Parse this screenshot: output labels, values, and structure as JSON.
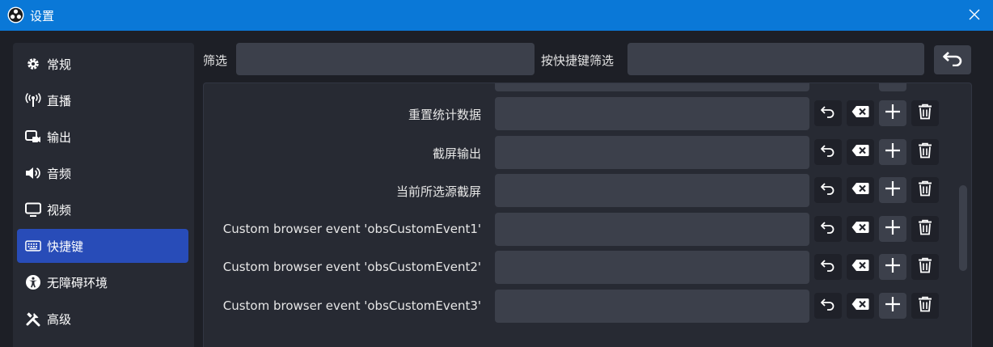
{
  "window": {
    "title": "设置",
    "app_icon": "obs-logo-icon",
    "close_icon": "close-icon"
  },
  "sidebar": {
    "items": [
      {
        "label": "常规",
        "icon": "gear-icon",
        "active": false
      },
      {
        "label": "直播",
        "icon": "antenna-icon",
        "active": false
      },
      {
        "label": "输出",
        "icon": "output-icon",
        "active": false
      },
      {
        "label": "音频",
        "icon": "speaker-icon",
        "active": false
      },
      {
        "label": "视频",
        "icon": "monitor-icon",
        "active": false
      },
      {
        "label": "快捷键",
        "icon": "keyboard-icon",
        "active": true
      },
      {
        "label": "无障碍环境",
        "icon": "accessibility-icon",
        "active": false
      },
      {
        "label": "高级",
        "icon": "tools-icon",
        "active": false
      }
    ]
  },
  "filter": {
    "label": "筛选",
    "value": "",
    "hotkey_label": "按快捷键筛选",
    "hotkey_value": "",
    "reset_icon": "undo-icon"
  },
  "hotkeys": {
    "rows": [
      {
        "label": "重置统计数据",
        "value": ""
      },
      {
        "label": "截屏输出",
        "value": ""
      },
      {
        "label": "当前所选源截屏",
        "value": ""
      },
      {
        "label": "Custom browser event 'obsCustomEvent1'",
        "value": ""
      },
      {
        "label": "Custom browser event 'obsCustomEvent2'",
        "value": ""
      },
      {
        "label": "Custom browser event 'obsCustomEvent3'",
        "value": ""
      }
    ],
    "row_buttons": [
      "undo-icon",
      "backspace-clear-icon",
      "plus-icon",
      "trash-icon"
    ]
  },
  "colors": {
    "titlebar": "#0a78d7",
    "background": "#1d1f26",
    "panel": "#272a33",
    "input": "#3c404b",
    "active_nav": "#284cb8",
    "text": "#e6e6e6"
  }
}
